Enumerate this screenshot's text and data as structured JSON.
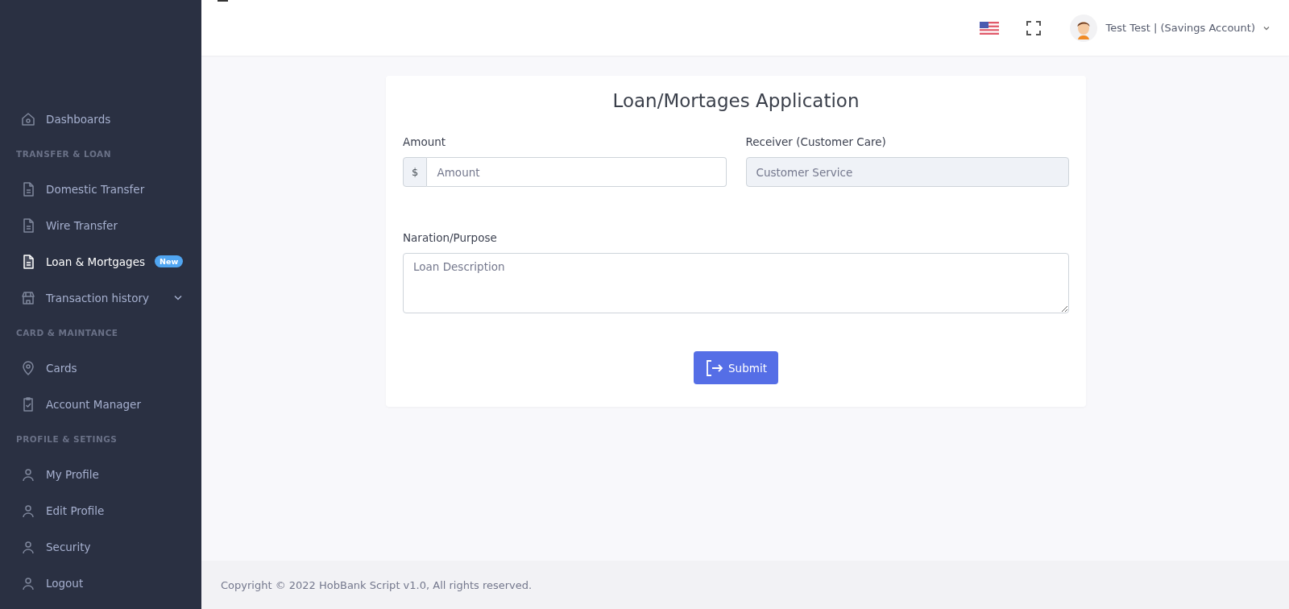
{
  "sidebar": {
    "sections": [
      {
        "items": [
          {
            "label": "Dashboards",
            "selected": false
          }
        ]
      },
      {
        "heading": "TRANSFER & LOAN",
        "items": [
          {
            "label": "Domestic Transfer",
            "selected": false
          },
          {
            "label": "Wire Transfer",
            "selected": false
          },
          {
            "label": "Loan & Mortgages",
            "selected": true,
            "badge": "New"
          },
          {
            "label": "Transaction history",
            "selected": false,
            "expanded": false
          }
        ]
      },
      {
        "heading": "CARD & MAINTANCE",
        "items": [
          {
            "label": "Cards",
            "selected": false
          },
          {
            "label": "Account Manager",
            "selected": false
          }
        ]
      },
      {
        "heading": "PROFILE & SETINGS",
        "items": [
          {
            "label": "My Profile",
            "selected": false
          },
          {
            "label": "Edit Profile",
            "selected": false
          },
          {
            "label": "Security",
            "selected": false
          },
          {
            "label": "Logout",
            "selected": false
          }
        ]
      }
    ]
  },
  "header": {
    "user": "Test Test | (Savings Account)"
  },
  "form": {
    "title": "Loan/Mortages Application",
    "amount": {
      "label": "Amount",
      "prefix": "$",
      "placeholder": "Amount"
    },
    "receiver": {
      "label": "Receiver (Customer Care)",
      "value": "Customer Service",
      "disabled": true
    },
    "purpose": {
      "label": "Naration/Purpose",
      "placeholder": "Loan Description"
    },
    "submit": "Submit"
  },
  "footer": "Copyright © 2022 HobBank Script v1.0, All rights reserved."
}
